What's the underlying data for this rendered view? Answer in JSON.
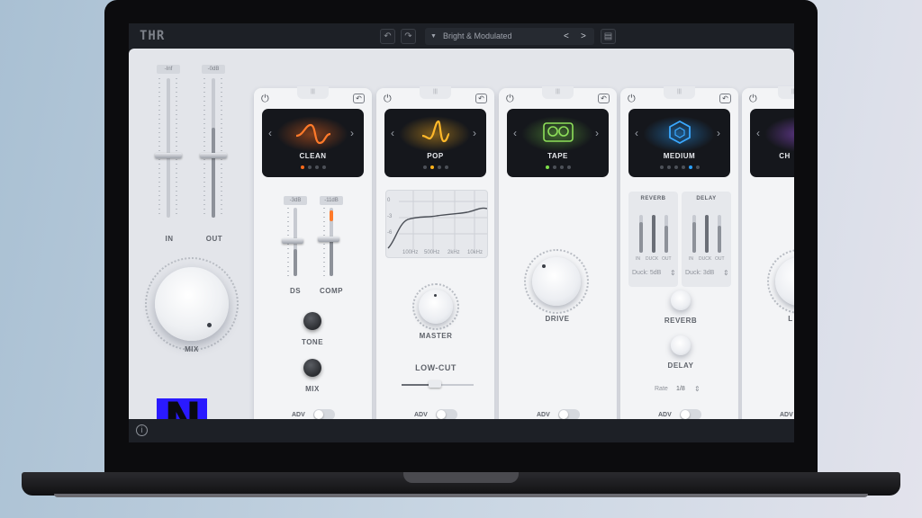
{
  "topbar": {
    "logo": "THR",
    "undo_icon": "undo-icon",
    "redo_icon": "redo-icon",
    "preset_name": "Bright & Modulated",
    "prev": "<",
    "next": ">",
    "save_icon": "save-icon"
  },
  "master": {
    "in_value": "-Inf",
    "out_value": "-0dB",
    "in_label": "IN",
    "out_label": "OUT",
    "mix_label": "MIX"
  },
  "modules": [
    {
      "name": "CLEAN",
      "accent": "#ff6a1a",
      "active_dot": 0,
      "ds_value": "-3dB",
      "comp_value": "-11dB",
      "ds_label": "DS",
      "comp_label": "COMP",
      "tone_label": "TONE",
      "mix_label": "MIX",
      "adv": "ADV"
    },
    {
      "name": "POP",
      "accent": "#ffb21a",
      "active_dot": 1,
      "eq_y_ticks": [
        "0",
        "-3",
        "-6"
      ],
      "eq_x_ticks": [
        "100Hz",
        "500Hz",
        "2kHz",
        "10kHz"
      ],
      "master_label": "MASTER",
      "lowcut_label": "LOW-CUT",
      "adv": "ADV"
    },
    {
      "name": "TAPE",
      "accent": "#7ee04a",
      "active_dot": 0,
      "drive_label": "DRIVE",
      "adv": "ADV"
    },
    {
      "name": "MEDIUM",
      "accent": "#2aa0ff",
      "active_dot": 4,
      "reverb_header": "REVERB",
      "delay_header": "DELAY",
      "meter_in": "IN",
      "meter_duck": "DUCK",
      "meter_out": "OUT",
      "reverb_duck": "Duck: 5dB",
      "delay_duck": "Duck: 3dB",
      "reverb_label": "REVERB",
      "delay_label": "DELAY",
      "rate_label": "Rate",
      "rate_value": "1/8",
      "adv": "ADV"
    },
    {
      "name": "CH",
      "accent": "#b05aff",
      "knob_label": "L",
      "adv": "ADV"
    }
  ],
  "bottombar": {
    "info": "i"
  },
  "watermark": "N"
}
